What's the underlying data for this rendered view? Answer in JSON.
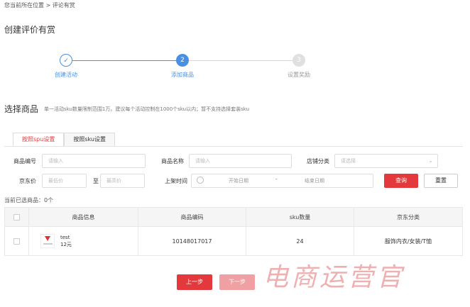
{
  "breadcrumb": "您当前所在位置 > 评论有赏",
  "page_title": "创建评价有赏",
  "steps": [
    {
      "number": "✓",
      "label": "创建活动"
    },
    {
      "number": "2",
      "label": "添加商品"
    },
    {
      "number": "3",
      "label": "设置奖励"
    }
  ],
  "section": {
    "title": "选择商品",
    "hint": "单一活动sku数量限制范围1万。建议每个活动控制在1000个sku以内；暂不支持选择套装sku"
  },
  "tabs": [
    {
      "label": "按照spu设置",
      "active": true
    },
    {
      "label": "按照sku设置",
      "active": false
    }
  ],
  "filters": {
    "product_code_label": "商品编号",
    "product_code_placeholder": "请输入",
    "product_name_label": "商品名称",
    "product_name_placeholder": "请输入",
    "store_category_label": "店铺分类",
    "store_category_placeholder": "请选择",
    "jd_price_label": "京东价",
    "min_price_placeholder": "最低价",
    "to_label": "至",
    "max_price_placeholder": "最高价",
    "shelf_time_label": "上架时间",
    "start_date_placeholder": "开始日期",
    "date_separator": "-",
    "end_date_placeholder": "结束日期",
    "query_button": "查询",
    "reset_button": "重置"
  },
  "selected_count": "当前已选商品：0个",
  "table": {
    "headers": [
      "商品信息",
      "商品编码",
      "sku数量",
      "京东分类"
    ],
    "rows": [
      {
        "name": "test",
        "price": "12元",
        "code": "10148017017",
        "sku_count": "24",
        "category": "服饰内衣/女装/T恤"
      }
    ]
  },
  "footer": {
    "prev_button": "上一步",
    "next_button": "下一步"
  },
  "watermark": "电商运营官",
  "colors": {
    "primary": "#4a90e2",
    "accent": "#e4393c"
  }
}
